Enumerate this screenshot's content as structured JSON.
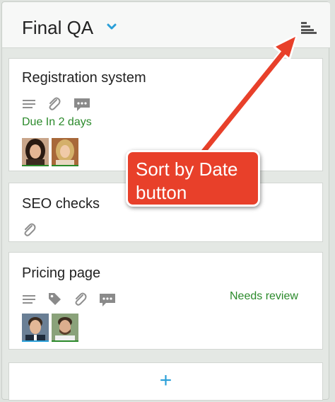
{
  "column": {
    "title": "Final QA",
    "sort_button_icon": "sort-by-date-icon",
    "chevron_icon": "chevron-down-icon"
  },
  "cards": [
    {
      "title": "Registration system",
      "icons": [
        "description-icon",
        "paperclip-icon",
        "comment-icon"
      ],
      "due": "Due In 2 days",
      "avatars": [
        "avatar-woman-dark-hair",
        "avatar-woman-blonde"
      ]
    },
    {
      "title": "SEO checks",
      "icons": [
        "paperclip-icon"
      ]
    },
    {
      "title": "Pricing page",
      "icons": [
        "description-icon",
        "tag-icon",
        "paperclip-icon",
        "comment-icon"
      ],
      "status": "Needs review",
      "avatars": [
        "avatar-man-suit",
        "avatar-man-beard"
      ]
    }
  ],
  "add_card": {
    "label": "+"
  },
  "annotation": {
    "text_line1": "Sort by Date",
    "text_line2": "button"
  },
  "colors": {
    "accent": "#2a9fd8",
    "status_green": "#2b8a2b",
    "callout_red": "#e8402a"
  }
}
